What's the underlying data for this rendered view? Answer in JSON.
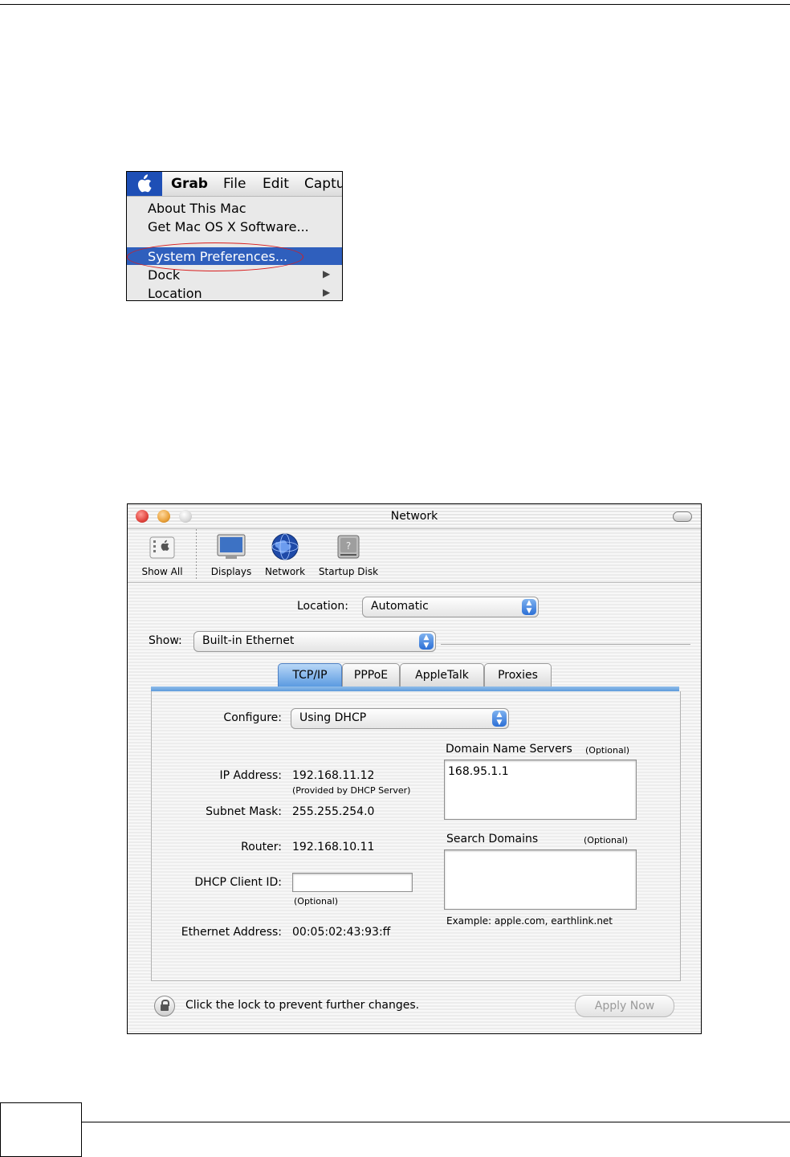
{
  "menu_screenshot": {
    "menubar": [
      "Grab",
      "File",
      "Edit",
      "Captu"
    ],
    "items": [
      {
        "label": "About This Mac",
        "submenu": false
      },
      {
        "label": "Get Mac OS X Software...",
        "submenu": false
      },
      {
        "label": "System Preferences...",
        "submenu": false,
        "highlighted": true
      },
      {
        "label": "Dock",
        "submenu": true
      },
      {
        "label": "Location",
        "submenu": true
      }
    ],
    "icons": {
      "apple": "apple-logo-icon",
      "submenu": "triangle-right-icon"
    }
  },
  "network_window": {
    "title": "Network",
    "toolbar": [
      "Show All",
      "Displays",
      "Network",
      "Startup Disk"
    ],
    "location": {
      "label": "Location:",
      "value": "Automatic"
    },
    "show": {
      "label": "Show:",
      "value": "Built-in Ethernet"
    },
    "tabs": [
      "TCP/IP",
      "PPPoE",
      "AppleTalk",
      "Proxies"
    ],
    "active_tab": "TCP/IP",
    "configure": {
      "label": "Configure:",
      "value": "Using DHCP"
    },
    "ip_address": {
      "label": "IP Address:",
      "value": "192.168.11.12",
      "note": "(Provided by DHCP Server)"
    },
    "subnet_mask": {
      "label": "Subnet Mask:",
      "value": "255.255.254.0"
    },
    "router": {
      "label": "Router:",
      "value": "192.168.10.11"
    },
    "dhcp_client_id": {
      "label": "DHCP Client ID:",
      "value": "",
      "note": "(Optional)"
    },
    "ethernet_address": {
      "label": "Ethernet Address:",
      "value": "00:05:02:43:93:ff"
    },
    "dns": {
      "label": "Domain Name Servers",
      "optional": "(Optional)",
      "value": "168.95.1.1"
    },
    "search_domains": {
      "label": "Search Domains",
      "optional": "(Optional)",
      "value": "",
      "example": "Example: apple.com, earthlink.net"
    },
    "lock_text": "Click the lock to prevent further changes.",
    "apply_button": "Apply Now",
    "colors": {
      "accent": "#3a7bd5",
      "close": "#e0443e",
      "minimize": "#e9a13a",
      "zoom": "#d8d8d8"
    }
  }
}
